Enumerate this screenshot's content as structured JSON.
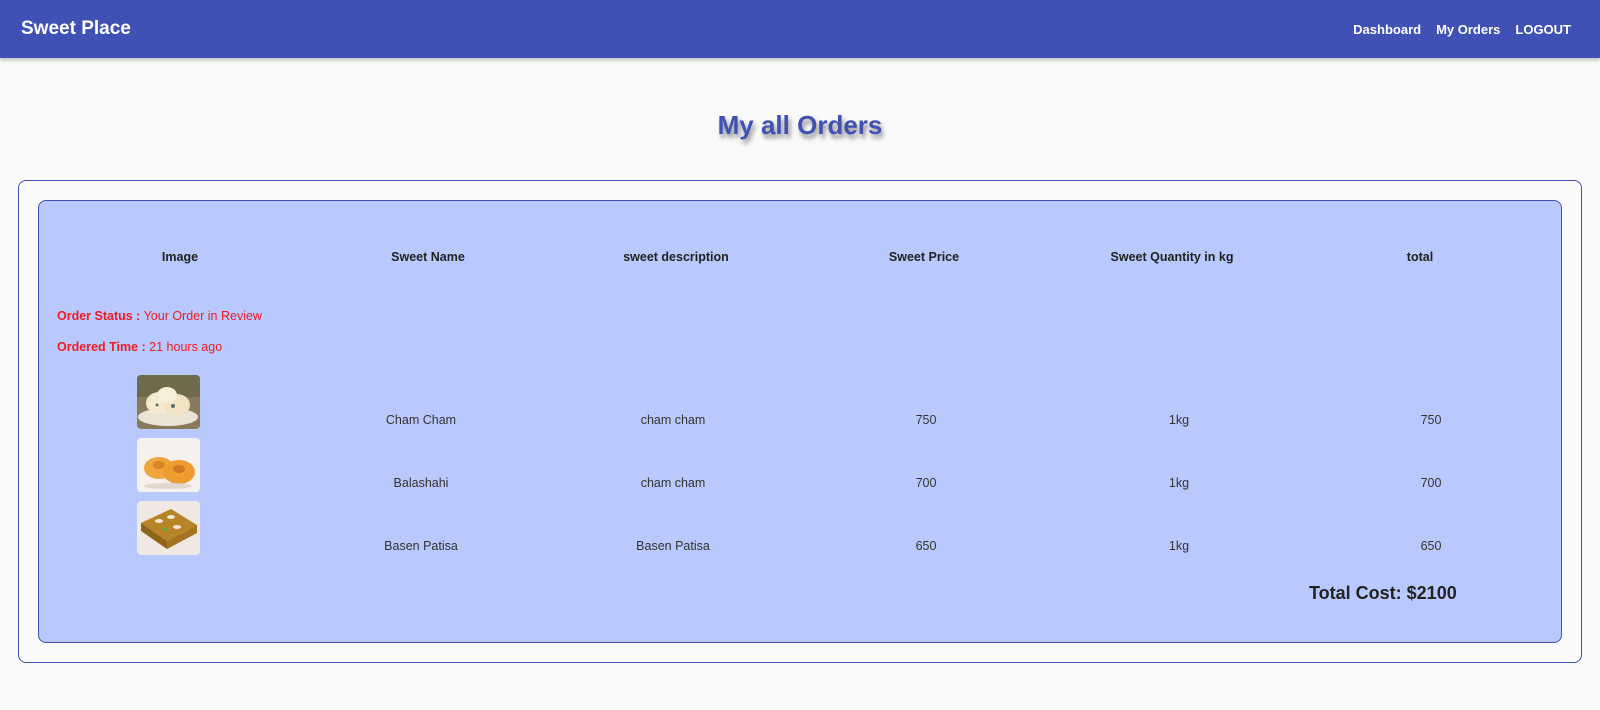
{
  "header": {
    "brand": "Sweet Place",
    "nav": [
      "Dashboard",
      "My Orders",
      "LOGOUT"
    ]
  },
  "page_title": "My all Orders",
  "table": {
    "columns": [
      "Image",
      "Sweet Name",
      "sweet description",
      "Sweet Price",
      "Sweet Quantity in kg",
      "total"
    ]
  },
  "order": {
    "status_label": "Order Status :",
    "status_value": "Your Order in Review",
    "time_label": "Ordered Time :",
    "time_value": "21 hours ago",
    "items": [
      {
        "image": "cham-cham-photo",
        "name": "Cham Cham",
        "description": "cham cham",
        "price": "750",
        "quantity": "1kg",
        "total": "750"
      },
      {
        "image": "balashahi-photo",
        "name": "Balashahi",
        "description": "cham cham",
        "price": "700",
        "quantity": "1kg",
        "total": "700"
      },
      {
        "image": "basen-patisa-photo",
        "name": "Basen Patisa",
        "description": "Basen Patisa",
        "price": "650",
        "quantity": "1kg",
        "total": "650"
      }
    ],
    "total_cost": "Total Cost: $2100"
  },
  "colors": {
    "primary": "#3f51b5",
    "card_bg": "#b9c9fd",
    "status_red": "#ef1c23",
    "page_bg": "#fafafa"
  }
}
